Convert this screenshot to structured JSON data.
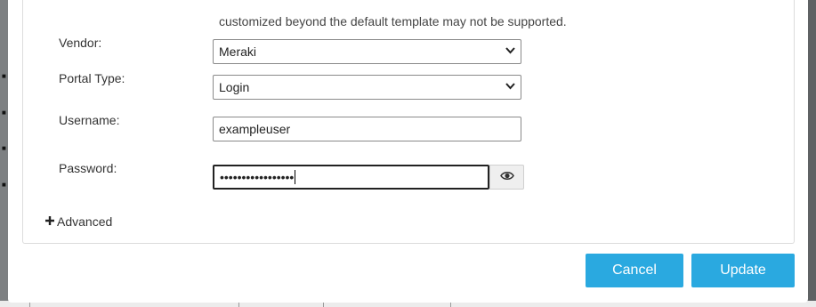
{
  "form": {
    "note": "customized beyond the default template may not be supported.",
    "vendor": {
      "label": "Vendor:",
      "value": "Meraki"
    },
    "portal_type": {
      "label": "Portal Type:",
      "value": "Login"
    },
    "username": {
      "label": "Username:",
      "value": "exampleuser"
    },
    "password": {
      "label": "Password:",
      "value": "•••••••••••••••••"
    },
    "advanced_label": "Advanced"
  },
  "actions": {
    "cancel_label": "Cancel",
    "update_label": "Update"
  },
  "colors": {
    "primary_button": "#2aa9e0",
    "overlay": "#5f6264"
  },
  "icons": {
    "dropdown": "chevron-down-icon",
    "reveal_password": "eye-icon",
    "advanced": "plus-icon"
  }
}
